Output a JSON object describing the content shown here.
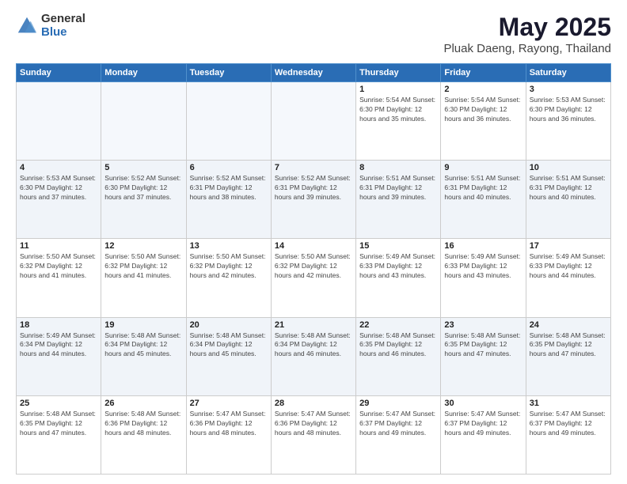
{
  "logo": {
    "general": "General",
    "blue": "Blue"
  },
  "header": {
    "title": "May 2025",
    "subtitle": "Pluak Daeng, Rayong, Thailand"
  },
  "weekdays": [
    "Sunday",
    "Monday",
    "Tuesday",
    "Wednesday",
    "Thursday",
    "Friday",
    "Saturday"
  ],
  "weeks": [
    [
      {
        "day": "",
        "info": ""
      },
      {
        "day": "",
        "info": ""
      },
      {
        "day": "",
        "info": ""
      },
      {
        "day": "",
        "info": ""
      },
      {
        "day": "1",
        "info": "Sunrise: 5:54 AM\nSunset: 6:30 PM\nDaylight: 12 hours\nand 35 minutes."
      },
      {
        "day": "2",
        "info": "Sunrise: 5:54 AM\nSunset: 6:30 PM\nDaylight: 12 hours\nand 36 minutes."
      },
      {
        "day": "3",
        "info": "Sunrise: 5:53 AM\nSunset: 6:30 PM\nDaylight: 12 hours\nand 36 minutes."
      }
    ],
    [
      {
        "day": "4",
        "info": "Sunrise: 5:53 AM\nSunset: 6:30 PM\nDaylight: 12 hours\nand 37 minutes."
      },
      {
        "day": "5",
        "info": "Sunrise: 5:52 AM\nSunset: 6:30 PM\nDaylight: 12 hours\nand 37 minutes."
      },
      {
        "day": "6",
        "info": "Sunrise: 5:52 AM\nSunset: 6:31 PM\nDaylight: 12 hours\nand 38 minutes."
      },
      {
        "day": "7",
        "info": "Sunrise: 5:52 AM\nSunset: 6:31 PM\nDaylight: 12 hours\nand 39 minutes."
      },
      {
        "day": "8",
        "info": "Sunrise: 5:51 AM\nSunset: 6:31 PM\nDaylight: 12 hours\nand 39 minutes."
      },
      {
        "day": "9",
        "info": "Sunrise: 5:51 AM\nSunset: 6:31 PM\nDaylight: 12 hours\nand 40 minutes."
      },
      {
        "day": "10",
        "info": "Sunrise: 5:51 AM\nSunset: 6:31 PM\nDaylight: 12 hours\nand 40 minutes."
      }
    ],
    [
      {
        "day": "11",
        "info": "Sunrise: 5:50 AM\nSunset: 6:32 PM\nDaylight: 12 hours\nand 41 minutes."
      },
      {
        "day": "12",
        "info": "Sunrise: 5:50 AM\nSunset: 6:32 PM\nDaylight: 12 hours\nand 41 minutes."
      },
      {
        "day": "13",
        "info": "Sunrise: 5:50 AM\nSunset: 6:32 PM\nDaylight: 12 hours\nand 42 minutes."
      },
      {
        "day": "14",
        "info": "Sunrise: 5:50 AM\nSunset: 6:32 PM\nDaylight: 12 hours\nand 42 minutes."
      },
      {
        "day": "15",
        "info": "Sunrise: 5:49 AM\nSunset: 6:33 PM\nDaylight: 12 hours\nand 43 minutes."
      },
      {
        "day": "16",
        "info": "Sunrise: 5:49 AM\nSunset: 6:33 PM\nDaylight: 12 hours\nand 43 minutes."
      },
      {
        "day": "17",
        "info": "Sunrise: 5:49 AM\nSunset: 6:33 PM\nDaylight: 12 hours\nand 44 minutes."
      }
    ],
    [
      {
        "day": "18",
        "info": "Sunrise: 5:49 AM\nSunset: 6:34 PM\nDaylight: 12 hours\nand 44 minutes."
      },
      {
        "day": "19",
        "info": "Sunrise: 5:48 AM\nSunset: 6:34 PM\nDaylight: 12 hours\nand 45 minutes."
      },
      {
        "day": "20",
        "info": "Sunrise: 5:48 AM\nSunset: 6:34 PM\nDaylight: 12 hours\nand 45 minutes."
      },
      {
        "day": "21",
        "info": "Sunrise: 5:48 AM\nSunset: 6:34 PM\nDaylight: 12 hours\nand 46 minutes."
      },
      {
        "day": "22",
        "info": "Sunrise: 5:48 AM\nSunset: 6:35 PM\nDaylight: 12 hours\nand 46 minutes."
      },
      {
        "day": "23",
        "info": "Sunrise: 5:48 AM\nSunset: 6:35 PM\nDaylight: 12 hours\nand 47 minutes."
      },
      {
        "day": "24",
        "info": "Sunrise: 5:48 AM\nSunset: 6:35 PM\nDaylight: 12 hours\nand 47 minutes."
      }
    ],
    [
      {
        "day": "25",
        "info": "Sunrise: 5:48 AM\nSunset: 6:35 PM\nDaylight: 12 hours\nand 47 minutes."
      },
      {
        "day": "26",
        "info": "Sunrise: 5:48 AM\nSunset: 6:36 PM\nDaylight: 12 hours\nand 48 minutes."
      },
      {
        "day": "27",
        "info": "Sunrise: 5:47 AM\nSunset: 6:36 PM\nDaylight: 12 hours\nand 48 minutes."
      },
      {
        "day": "28",
        "info": "Sunrise: 5:47 AM\nSunset: 6:36 PM\nDaylight: 12 hours\nand 48 minutes."
      },
      {
        "day": "29",
        "info": "Sunrise: 5:47 AM\nSunset: 6:37 PM\nDaylight: 12 hours\nand 49 minutes."
      },
      {
        "day": "30",
        "info": "Sunrise: 5:47 AM\nSunset: 6:37 PM\nDaylight: 12 hours\nand 49 minutes."
      },
      {
        "day": "31",
        "info": "Sunrise: 5:47 AM\nSunset: 6:37 PM\nDaylight: 12 hours\nand 49 minutes."
      }
    ]
  ]
}
